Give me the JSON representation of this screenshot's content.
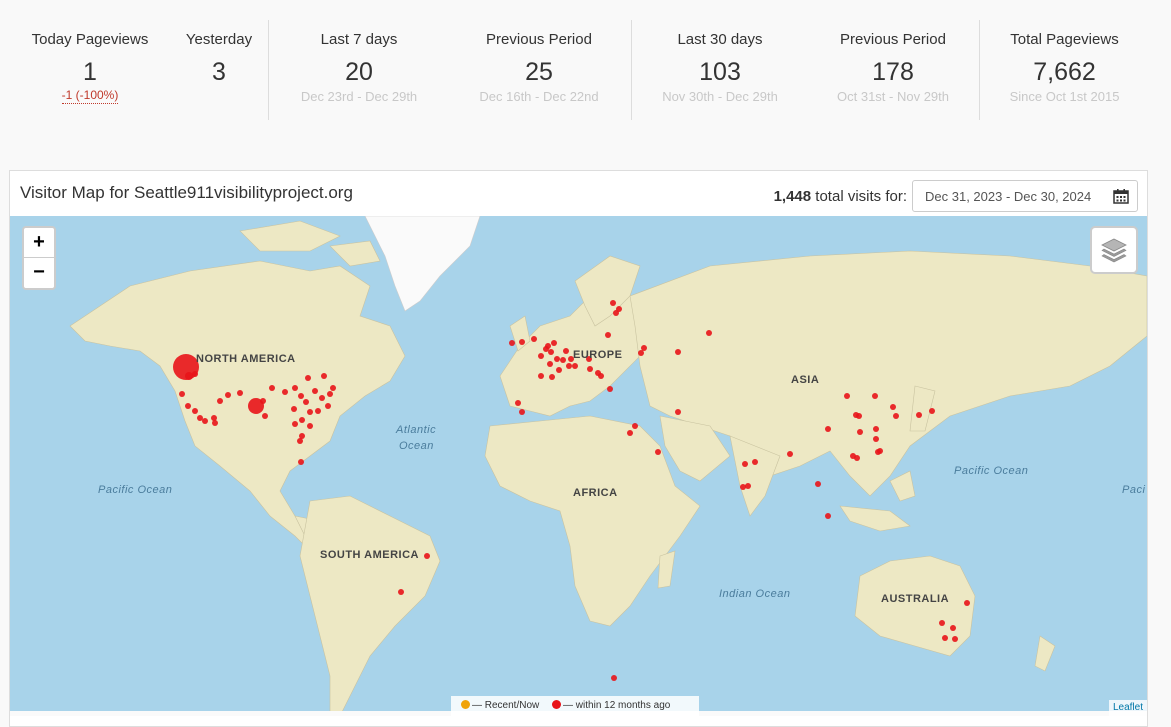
{
  "stats": {
    "today": {
      "label": "Today Pageviews",
      "value": "1",
      "change": "-1 (-100%)"
    },
    "yesterday": {
      "label": "Yesterday",
      "value": "3"
    },
    "last7": {
      "label": "Last 7 days",
      "value": "20",
      "range": "Dec 23rd - Dec 29th"
    },
    "prev7": {
      "label": "Previous Period",
      "value": "25",
      "range": "Dec 16th - Dec 22nd"
    },
    "last30": {
      "label": "Last 30 days",
      "value": "103",
      "range": "Nov 30th - Dec 29th"
    },
    "prev30": {
      "label": "Previous Period",
      "value": "178",
      "range": "Oct 31st - Nov 29th"
    },
    "total": {
      "label": "Total Pageviews",
      "value": "7,662",
      "since": "Since Oct 1st 2015"
    }
  },
  "map_panel": {
    "title": "Visitor Map for Seattle911visibilityproject.org",
    "total_visits": "1,448",
    "total_visits_suffix": "total visits for:",
    "date_range": "Dec 31, 2023 - Dec 30, 2024",
    "calendar_icon": "calendar-icon"
  },
  "map": {
    "zoom_in": "+",
    "zoom_out": "−",
    "layers_icon": "layers-icon",
    "labels": {
      "north_america": "NORTH AMERICA",
      "south_america": "SOUTH AMERICA",
      "europe": "EUROPE",
      "asia": "ASIA",
      "africa": "AFRICA",
      "australia": "AUSTRALIA",
      "atlantic": "Atlantic",
      "atlantic2": "Ocean",
      "pacific_w": "Pacific Ocean",
      "pacific_e": "Pacific Ocean",
      "pacific_far": "Paci",
      "indian": "Indian Ocean"
    },
    "legend": {
      "recent": "— Recent/Now",
      "recent_color": "#f0a30a",
      "older": "— within 12 months ago",
      "older_color": "#e8141a"
    },
    "attribution": "Leaflet"
  }
}
